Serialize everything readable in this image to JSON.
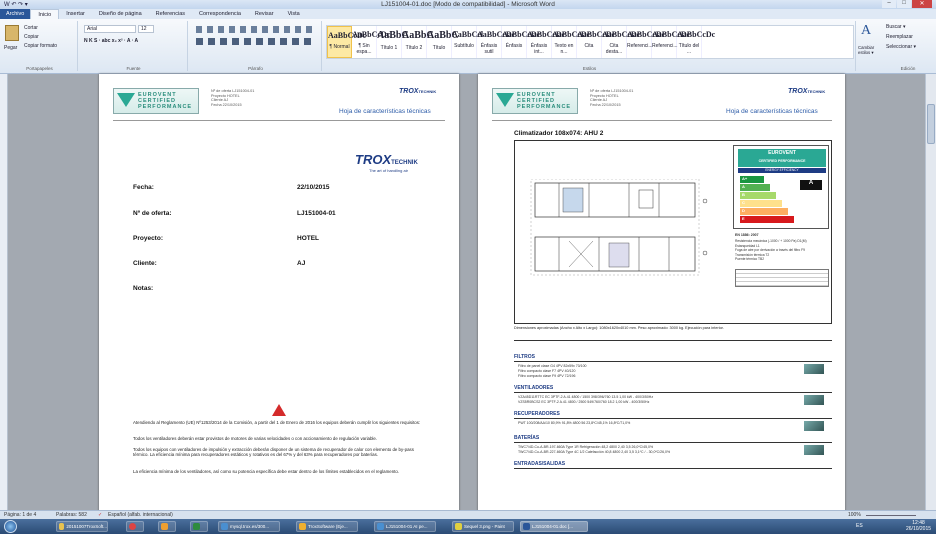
{
  "window": {
    "title": "LJ151004-01.doc [Modo de compatibilidad] - Microsoft Word",
    "quick_access": "W ↶ ↷ ▾",
    "controls": [
      "–",
      "□",
      "✕"
    ]
  },
  "ribbon_tabs": [
    "Archivo",
    "Inicio",
    "Insertar",
    "Diseño de página",
    "Referencias",
    "Correspondencia",
    "Revisar",
    "Vista"
  ],
  "ribbon": {
    "clipboard": {
      "paste": "Pegar",
      "cut": "Cortar",
      "copy": "Copiar",
      "format": "Copiar formato",
      "label": "Portapapeles"
    },
    "font": {
      "name": "Arial",
      "size": "12",
      "label": "Fuente",
      "row2": "N K S · abc x₂ x² · A · A"
    },
    "paragraph": {
      "label": "Párrafo"
    },
    "styles": {
      "label": "Estilos",
      "items": [
        {
          "sample": "AaBbCcDc",
          "name": "¶ Normal"
        },
        {
          "sample": "AaBbCcDc",
          "name": "¶ Sin espa..."
        },
        {
          "sample": "AaBbC",
          "name": "Título 1"
        },
        {
          "sample": "AaBbC",
          "name": "Título 2"
        },
        {
          "sample": "AaBbC",
          "name": "Título"
        },
        {
          "sample": "AaBbCcl",
          "name": "Subtítulo"
        },
        {
          "sample": "AaBbCcDc",
          "name": "Énfasis sutil"
        },
        {
          "sample": "AaBbCcDc",
          "name": "Énfasis"
        },
        {
          "sample": "AaBbCcDc",
          "name": "Énfasis int..."
        },
        {
          "sample": "AaBbCcDc",
          "name": "Texto en n..."
        },
        {
          "sample": "AaBbCcDc",
          "name": "Cita"
        },
        {
          "sample": "AaBbCcDc",
          "name": "Cita desta..."
        },
        {
          "sample": "AaBbCcDc",
          "name": "Referenci..."
        },
        {
          "sample": "AaBbCcDc",
          "name": "Referenci..."
        },
        {
          "sample": "AaBbCcDc",
          "name": "Título del ..."
        }
      ],
      "change": "Cambiar estilos ▾"
    },
    "editing": {
      "label": "Edición",
      "find": "Buscar ▾",
      "replace": "Reemplazar",
      "select": "Seleccionar ▾"
    }
  },
  "page1": {
    "brand_lines": [
      "EUROVENT",
      "CERTIFIED",
      "PERFORMANCE"
    ],
    "info": [
      "Nº de oferta   LJ151004-01",
      "Proyecto   HOTEL",
      "Cliente   AJ",
      "Fecha   22/10/2015"
    ],
    "trox": "TROX",
    "trox_sub": "TECHNIK",
    "trox_tag": "The art of handling air",
    "hoja": "Hoja de características técnicas",
    "fields": [
      {
        "label": "Fecha:",
        "value": "22/10/2015"
      },
      {
        "label": "Nº de oferta:",
        "value": "LJ151004-01"
      },
      {
        "label": "Proyecto:",
        "value": "HOTEL"
      },
      {
        "label": "Cliente:",
        "value": "AJ"
      },
      {
        "label": "Notas:",
        "value": ""
      }
    ],
    "paragraphs": [
      "Atendiendo al Reglamento (UE) Nº1253/2014 de la Comisión, a partir del 1 de Enero de 2016 los equipos deberán cumplir los siguientes requisitos:",
      "Todos los ventiladores deberán estar provistos de motores de varias velocidades o con accionamiento de regulación variable.",
      "Todos los equipos con ventiladores de impulsión y extracción deberán disponer de un sistema de recuperador de calor con elemento de by-pass térmico. La eficiencia mínima para recuperadores estáticos y rotativos es del 67% y del 63% para recuperadores por baterías.",
      "La eficiencia mínima de los ventiladores, así como su potencia específica debe estar dentro de los límites establecidos en el reglamento."
    ]
  },
  "page2": {
    "title": "Climatizador 108x074: AHU 2",
    "energy_label": {
      "title": "EUROVENT",
      "sub": "CERTIFIED PERFORMANCE",
      "band": "ENERGY EFFICIENCY",
      "classes": [
        "A+",
        "A",
        "B",
        "C",
        "D",
        "E"
      ]
    },
    "en_title": "EN 1886: 2007",
    "en_rows": [
      "Resistencia mecánica (-1000 / + 1000 Pa)   D1(M)",
      "Estanqueidad   L1",
      "Fuga de aire por derivación a través del filtro   F9",
      "Transmisión térmica   T2",
      "Puente térmico   TB2"
    ],
    "dims_text": "Dimensiones aproximadas (Ancho x Alto x Largo): 1080x1620x4010 mm. Peso aproximado: 3000 kg. Ejecución para interior.",
    "sections": [
      {
        "name": "FILTROS",
        "rows": [
          "Filtro de panel  clase G4   4PV   82x59x   70/100",
          "Filtro compacto  clase F7   4PV   40/120",
          "Filtro compacto  clase F9   4PV   72/196"
        ]
      },
      {
        "name": "VENTILADORES",
        "rows": [
          "VZA45D11RTTC  EC 3PTF-2   A.41   4800 / 1500   398/396/760   13.5   1,00 kW - 400/3/50Hz",
          "VZS5R0BCS2  EC 3PTF-2   A.41   4800 / 2500   549/760/760   18.2   1,00 kW - 400/3/50Hz"
        ]
      },
      {
        "name": "RECUPERADORES",
        "rows": [
          "PWT 100/208/AA/10   80,9%   91,8%   4800   56   23,8ºC/45,1%   16,8ºC/71,0%"
        ]
      },
      {
        "name": "BATERÍAS",
        "rows": [
          "TWC7/4D-Cu-A-BR-197-660A  Type 1R   Refrigeración   48,2   4800   2,40   3,5   26,0ºC/45,0%",
          "TWC7/4D-Cu-A-BR-227-660A  Type 4C 1/2   Calefacción   40,8   4800   2,40   3,5   3,1ºC / -   30,0ºC/26,0%"
        ]
      },
      {
        "name": "ENTRADAS/SALIDAS",
        "rows": []
      }
    ]
  },
  "statusbar": {
    "page": "Página: 1 de 4",
    "words": "Palabras: 582",
    "lang": "Español (alfab. internacional)",
    "zoom": "100%"
  },
  "taskbar": {
    "items": [
      "20151007TroxSoft...",
      "",
      "",
      "",
      "mysql.trox.es/300...",
      "TroxSoftware (Eje...",
      "LJ151004-01 AI pe...",
      "Sequel 3.png - Paint",
      "LJ151004-01.doc [..."
    ],
    "clock_time": "12:48",
    "clock_date": "26/10/2015",
    "lang": "ES"
  }
}
